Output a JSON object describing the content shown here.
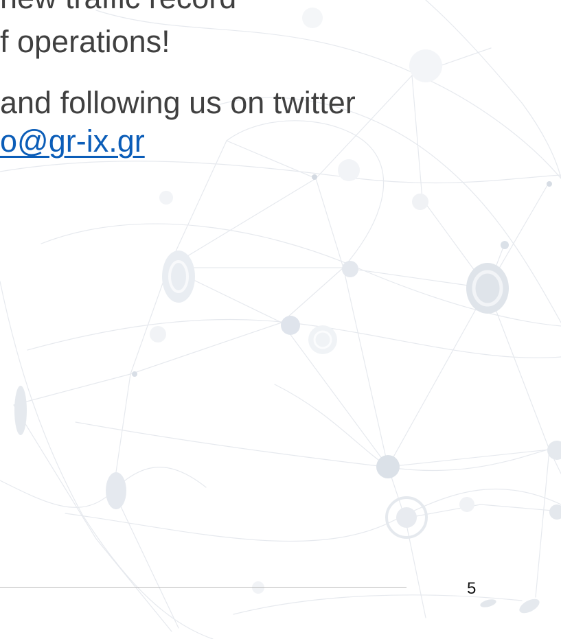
{
  "slide": {
    "clipped_top_text": "new traffic record",
    "operations_text": "f operations!",
    "follow_text": "and following us on twitter",
    "email_text": "o@gr-ix.gr",
    "page_number": "5"
  },
  "colors": {
    "text": "#404040",
    "link": "#0b5db8",
    "rule": "#b9b9b9",
    "network": "#dfe3ea"
  },
  "decoration": {
    "background_icon": "network-globe-icon"
  }
}
